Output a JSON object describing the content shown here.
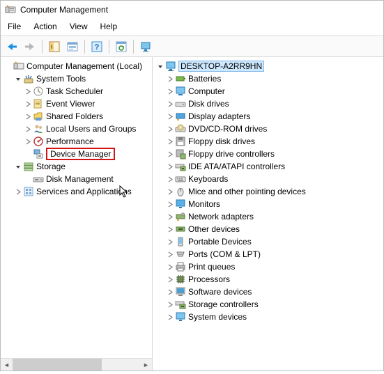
{
  "window": {
    "title": "Computer Management"
  },
  "menu": {
    "file": "File",
    "action": "Action",
    "view": "View",
    "help": "Help"
  },
  "left": {
    "root": "Computer Management (Local)",
    "system_tools": "System Tools",
    "task_scheduler": "Task Scheduler",
    "event_viewer": "Event Viewer",
    "shared_folders": "Shared Folders",
    "local_users": "Local Users and Groups",
    "performance": "Performance",
    "device_manager": "Device Manager",
    "storage": "Storage",
    "disk_management": "Disk Management",
    "services_apps": "Services and Applications"
  },
  "right": {
    "computer_name": "DESKTOP-A2RR9HN",
    "items": {
      "batteries": "Batteries",
      "computer": "Computer",
      "disk_drives": "Disk drives",
      "display_adapters": "Display adapters",
      "dvd": "DVD/CD-ROM drives",
      "floppy_drives": "Floppy disk drives",
      "floppy_controllers": "Floppy drive controllers",
      "ide": "IDE ATA/ATAPI controllers",
      "keyboards": "Keyboards",
      "mice": "Mice and other pointing devices",
      "monitors": "Monitors",
      "network": "Network adapters",
      "other": "Other devices",
      "portable": "Portable Devices",
      "ports": "Ports (COM & LPT)",
      "print_queues": "Print queues",
      "processors": "Processors",
      "software": "Software devices",
      "storage_ctrl": "Storage controllers",
      "system_dev": "System devices"
    }
  }
}
